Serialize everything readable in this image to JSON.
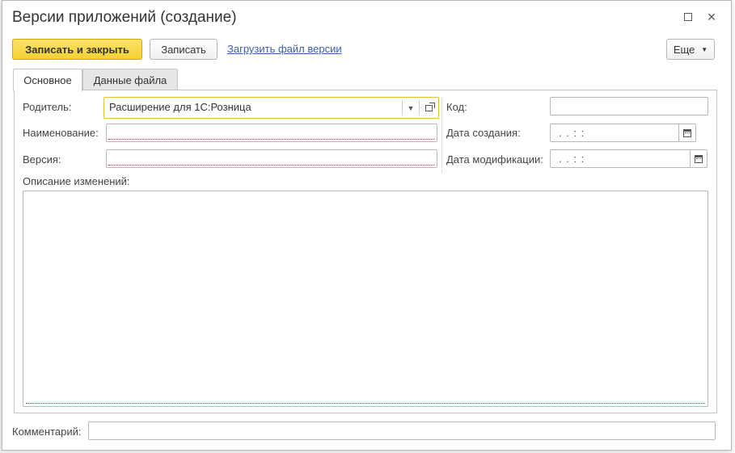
{
  "window": {
    "title": "Версии приложений (создание)"
  },
  "toolbar": {
    "save_close_label": "Записать и закрыть",
    "save_label": "Записать",
    "load_file_link": "Загрузить файл версии",
    "more_label": "Еще"
  },
  "tabs": [
    {
      "label": "Основное",
      "active": true
    },
    {
      "label": "Данные файла",
      "active": false
    }
  ],
  "form": {
    "parent_label": "Родитель:",
    "parent_value": "Расширение для 1С:Розница",
    "name_label": "Наименование:",
    "name_value": "",
    "version_label": "Версия:",
    "version_value": "",
    "code_label": "Код:",
    "code_value": "",
    "created_label": "Дата создания:",
    "created_value": ". .   : :",
    "modified_label": "Дата модификации:",
    "modified_value": ". .   : :",
    "description_label": "Описание изменений:",
    "description_value": ""
  },
  "footer": {
    "comment_label": "Комментарий:",
    "comment_value": ""
  },
  "colors": {
    "primary_button": "#f5d130",
    "link": "#3a5ea8",
    "focus_border": "#e4c13a"
  }
}
